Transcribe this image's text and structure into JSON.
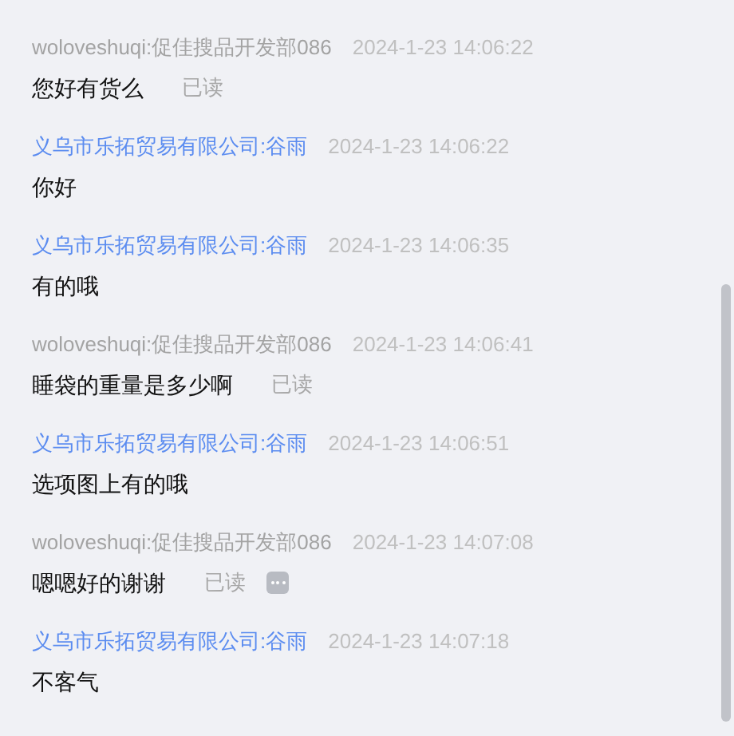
{
  "messages": [
    {
      "kind": "customer",
      "sender": "woloveshuqi:促佳搜品开发部086",
      "time": "2024-1-23 14:06:22",
      "text": "您好有货么",
      "status": "已读",
      "more_button": false
    },
    {
      "kind": "seller",
      "sender": "义乌市乐拓贸易有限公司:谷雨",
      "time": "2024-1-23 14:06:22",
      "text": "你好",
      "more_button": false
    },
    {
      "kind": "seller",
      "sender": "义乌市乐拓贸易有限公司:谷雨",
      "time": "2024-1-23 14:06:35",
      "text": "有的哦",
      "more_button": false
    },
    {
      "kind": "customer",
      "sender": "woloveshuqi:促佳搜品开发部086",
      "time": "2024-1-23 14:06:41",
      "text": "睡袋的重量是多少啊",
      "status": "已读",
      "more_button": false
    },
    {
      "kind": "seller",
      "sender": "义乌市乐拓贸易有限公司:谷雨",
      "time": "2024-1-23 14:06:51",
      "text": "选项图上有的哦",
      "more_button": false
    },
    {
      "kind": "customer",
      "sender": "woloveshuqi:促佳搜品开发部086",
      "time": "2024-1-23 14:07:08",
      "text": "嗯嗯好的谢谢",
      "status": "已读",
      "more_button": true
    },
    {
      "kind": "seller",
      "sender": "义乌市乐拓贸易有限公司:谷雨",
      "time": "2024-1-23 14:07:18",
      "text": "不客气",
      "more_button": false
    }
  ]
}
